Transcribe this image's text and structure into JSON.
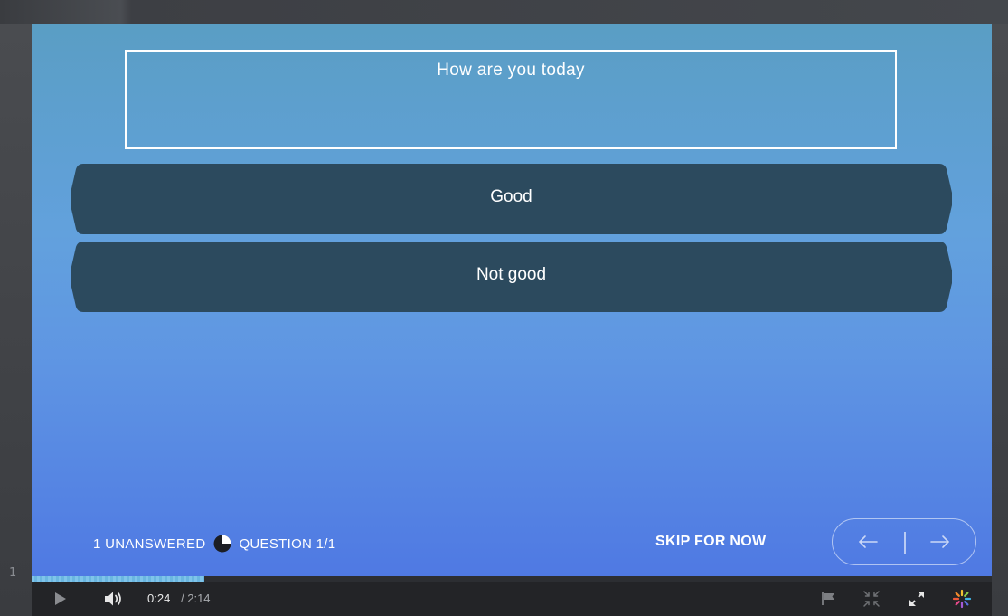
{
  "frame": {
    "row_number": "1"
  },
  "quiz": {
    "question": "How are you today",
    "answers": [
      {
        "label": "Good"
      },
      {
        "label": "Not good"
      }
    ],
    "status": {
      "unanswered": "1 UNANSWERED",
      "question_counter": "QUESTION 1/1"
    },
    "skip_label": "SKIP FOR NOW",
    "nav": {
      "prev_icon": "arrow-left-icon",
      "next_icon": "arrow-right-icon"
    }
  },
  "player": {
    "progress_fraction": 0.18,
    "current_time": "0:24",
    "total_time": "/ 2:14",
    "icons": [
      "play-icon",
      "volume-icon",
      "flag-icon",
      "shrink-icon",
      "fullscreen-icon",
      "brand-logo-icon"
    ]
  },
  "colors": {
    "answer_fill": "#2c4a5e",
    "stage_top": "#5a9ec4",
    "stage_bottom": "#4f79e3",
    "progress": "#7fc4ea",
    "player_bg": "#232427"
  }
}
